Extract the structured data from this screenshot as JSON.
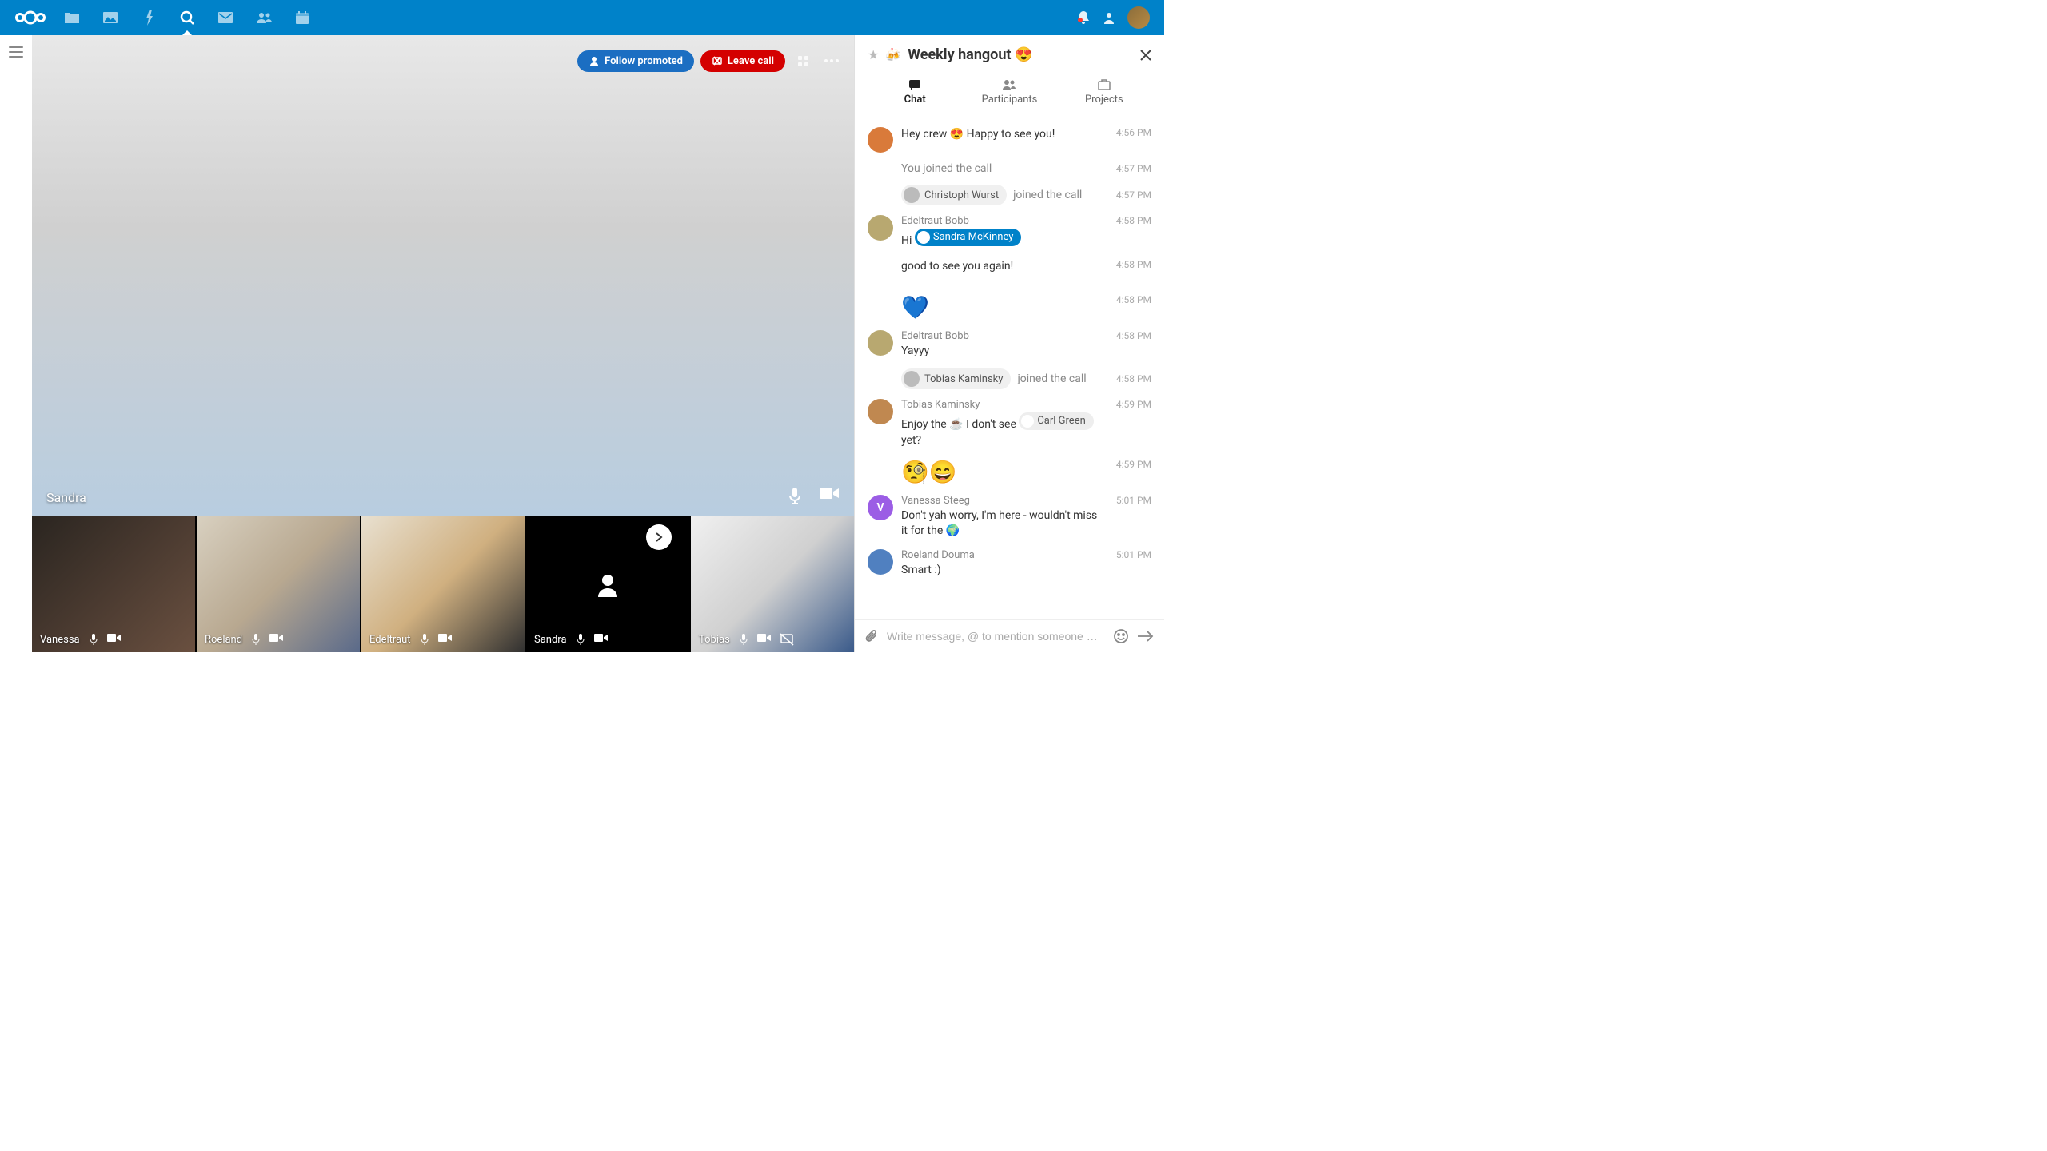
{
  "nav": {
    "apps": [
      "files",
      "photos",
      "activity",
      "talk",
      "mail",
      "contacts",
      "calendar"
    ]
  },
  "call": {
    "follow_promoted": "Follow promoted",
    "leave_call": "Leave call",
    "main_name": "Sandra",
    "thumbs": [
      {
        "name": "Vanessa"
      },
      {
        "name": "Roeland"
      },
      {
        "name": "Edeltraut"
      },
      {
        "name": "Sandra"
      },
      {
        "name": "Tobias"
      }
    ]
  },
  "sidebar": {
    "title": "Weekly hangout 😍",
    "title_icon": "🍻",
    "tabs": {
      "chat": "Chat",
      "participants": "Participants",
      "projects": "Projects"
    },
    "messages": [
      {
        "type": "msg",
        "author": "",
        "text": "Hey crew 😍 Happy to see you!",
        "time": "4:56 PM",
        "avatar": "a"
      },
      {
        "type": "sys",
        "text": "You joined the call",
        "time": "4:57 PM"
      },
      {
        "type": "join",
        "user": "Christoph Wurst",
        "suffix": "joined the call",
        "time": "4:57 PM"
      },
      {
        "type": "msg",
        "author": "Edeltraut Bobb",
        "text_parts": [
          "Hi ",
          {
            "mention": "Sandra McKinney",
            "blue": true
          }
        ],
        "time": "4:58 PM",
        "avatar": "e"
      },
      {
        "type": "cont",
        "text": "good to see you again!",
        "time": "4:58 PM"
      },
      {
        "type": "cont",
        "emoji": "💙",
        "time": "4:58 PM"
      },
      {
        "type": "msg",
        "author": "Edeltraut Bobb",
        "text": "Yayyy",
        "time": "4:58 PM",
        "avatar": "e"
      },
      {
        "type": "join",
        "user": "Tobias Kaminsky",
        "suffix": "joined the call",
        "time": "4:58 PM"
      },
      {
        "type": "msg",
        "author": "Tobias Kaminsky",
        "text_parts": [
          "Enjoy the ☕ I don't see ",
          {
            "mention": "Carl Green",
            "blue": false
          },
          " yet?"
        ],
        "time": "4:59 PM",
        "avatar": "t"
      },
      {
        "type": "cont",
        "emoji": "🧐😄",
        "time": "4:59 PM"
      },
      {
        "type": "msg",
        "author": "Vanessa Steeg",
        "text": "Don't yah worry, I'm here - wouldn't miss it for the 🌍",
        "time": "5:01 PM",
        "avatar": "v",
        "letter": "V"
      },
      {
        "type": "msg",
        "author": "Roeland Douma",
        "text": "Smart :)",
        "time": "5:01 PM",
        "avatar": "r"
      }
    ],
    "input_placeholder": "Write message, @ to mention someone …"
  }
}
